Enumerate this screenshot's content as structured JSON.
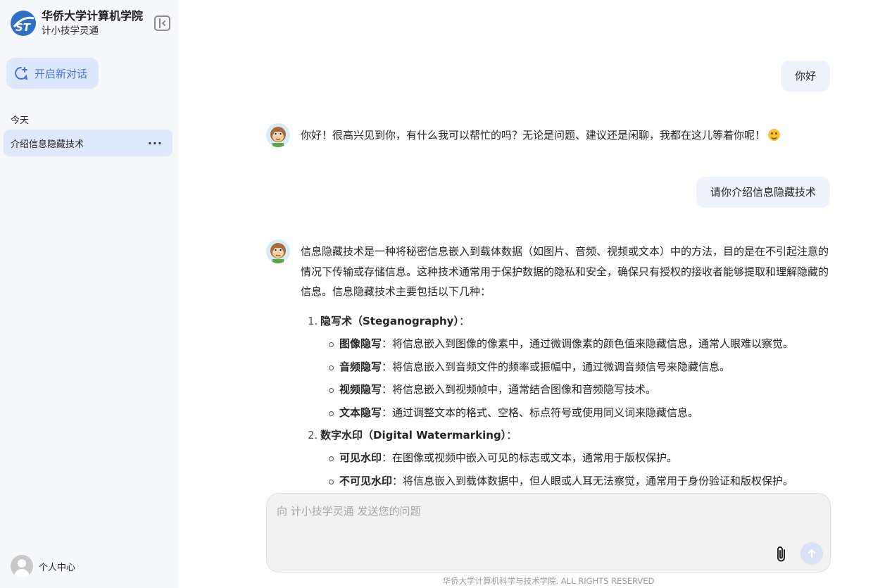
{
  "sidebar": {
    "brand_title": "华侨大学计算机学院",
    "brand_subtitle": "计小技学灵通",
    "new_chat_label": "开启新对话",
    "section_today": "今天",
    "history": [
      {
        "title": "介绍信息隐藏技术",
        "more": "···"
      }
    ],
    "profile_label": "个人中心"
  },
  "chat": {
    "messages": [
      {
        "role": "user",
        "text": "你好"
      },
      {
        "role": "assistant",
        "text": "你好！很高兴见到你，有什么我可以帮忙的吗？无论是问题、建议还是闲聊，我都在这儿等着你呢！"
      },
      {
        "role": "user",
        "text": "请你介绍信息隐藏技术"
      },
      {
        "role": "assistant",
        "intro": "信息隐藏技术是一种将秘密信息嵌入到载体数据（如图片、音频、视频或文本）中的方法，目的是在不引起注意的情况下传输或存储信息。这种技术通常用于保护数据的隐私和安全，确保只有授权的接收者能够提取和理解隐藏的信息。信息隐藏技术主要包括以下几种：",
        "items": [
          {
            "num": "1.",
            "title": "隐写术（Steganography）",
            "suffix": "：",
            "subs": [
              {
                "key": "图像隐写",
                "desc": "：将信息嵌入到图像的像素中，通过微调像素的颜色值来隐藏信息，通常人眼难以察觉。"
              },
              {
                "key": "音频隐写",
                "desc": "：将信息嵌入到音频文件的频率或振幅中，通过微调音频信号来隐藏信息。"
              },
              {
                "key": "视频隐写",
                "desc": "：将信息嵌入到视频帧中，通常结合图像和音频隐写技术。"
              },
              {
                "key": "文本隐写",
                "desc": "：通过调整文本的格式、空格、标点符号或使用同义词来隐藏信息。"
              }
            ]
          },
          {
            "num": "2.",
            "title": "数字水印（Digital Watermarking）",
            "suffix": "：",
            "subs": [
              {
                "key": "可见水印",
                "desc": "：在图像或视频中嵌入可见的标志或文本，通常用于版权保护。"
              },
              {
                "key": "不可见水印",
                "desc": "：将信息嵌入到载体数据中，但人眼或人耳无法察觉，通常用于身份验证和版权保护。"
              }
            ]
          }
        ]
      }
    ]
  },
  "input": {
    "placeholder": "向 计小技学灵通 发送您的问题"
  },
  "footer": "华侨大学计算机科学与技术学院. ALL RIGHTS RESERVED",
  "colors": {
    "accent": "#4a72d6",
    "sidebar_bg": "#f7f8fc",
    "active_item_bg": "#dfe9fd",
    "user_bubble_bg": "#eef3fd"
  }
}
